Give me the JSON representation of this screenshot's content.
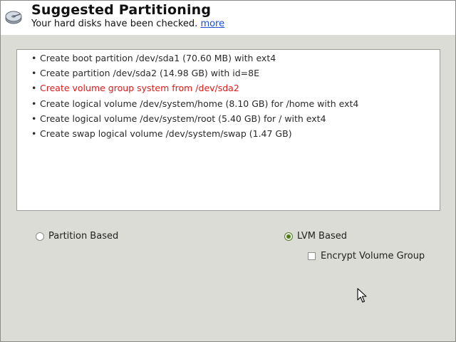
{
  "header": {
    "title": "Suggested Partitioning",
    "subtitle": "Your hard disks have been checked.",
    "more_link": "more"
  },
  "summary": {
    "items": [
      {
        "text": "Create boot partition /dev/sda1 (70.60 MB) with ext4",
        "highlight": false
      },
      {
        "text": "Create partition /dev/sda2 (14.98 GB) with id=8E",
        "highlight": false
      },
      {
        "text": "Create volume group system from /dev/sda2",
        "highlight": true
      },
      {
        "text": "Create logical volume /dev/system/home (8.10 GB) for /home with ext4",
        "highlight": false
      },
      {
        "text": "Create logical volume /dev/system/root (5.40 GB) for / with ext4",
        "highlight": false
      },
      {
        "text": "Create swap logical volume /dev/system/swap (1.47 GB)",
        "highlight": false
      }
    ],
    "bullet": "•"
  },
  "options": {
    "partition_based": {
      "label": "Partition Based",
      "selected": false
    },
    "lvm_based": {
      "label": "LVM Based",
      "selected": true
    },
    "encrypt_volume_group": {
      "label": "Encrypt Volume Group",
      "checked": false
    }
  },
  "colors": {
    "highlight": "#e01a1a",
    "link": "#1a4fd6",
    "window_bg": "#dcdcd6",
    "radio_selected": "#4f7a1e"
  },
  "icons": {
    "header_icon": "hard-disk-icon",
    "pointer": "mouse-pointer-icon"
  }
}
